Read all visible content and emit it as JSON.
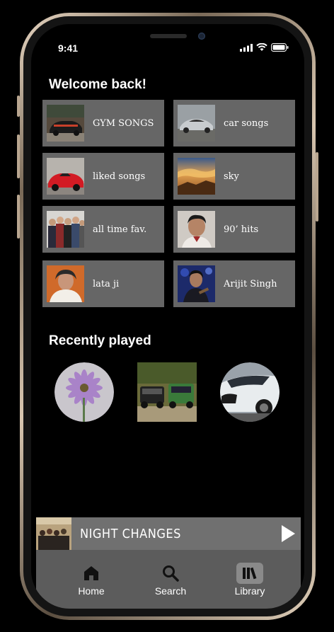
{
  "status": {
    "time": "9:41"
  },
  "welcome": {
    "title": "Welcome  back!",
    "tiles": [
      {
        "label": "GYM SONGS",
        "thumb": "black-sports-car"
      },
      {
        "label": "car songs",
        "thumb": "silver-sports-car"
      },
      {
        "label": "liked songs",
        "thumb": "red-sports-car"
      },
      {
        "label": "sky",
        "thumb": "sunset-sky"
      },
      {
        "label": "all time fav.",
        "thumb": "band-photo"
      },
      {
        "label": "90’ hits",
        "thumb": "singer-portrait"
      },
      {
        "label": "lata ji",
        "thumb": "lata-ji-portrait"
      },
      {
        "label": "Arijit Singh",
        "thumb": "arijit-singh-portrait"
      }
    ]
  },
  "recent": {
    "title": "Recently played",
    "items": [
      {
        "thumb": "purple-daisy-flower"
      },
      {
        "thumb": "green-suvs"
      },
      {
        "thumb": "white-car-front"
      }
    ]
  },
  "player": {
    "title": "NIGHT CHANGES",
    "thumb": "one-direction-album"
  },
  "tabs": [
    {
      "label": "Home",
      "icon": "home-icon"
    },
    {
      "label": "Search",
      "icon": "search-icon"
    },
    {
      "label": "Library",
      "icon": "library-icon"
    }
  ],
  "colors": {
    "tile": "#666666",
    "player": "#707070",
    "tabbar": "#5c5c5c",
    "background": "#000000"
  }
}
